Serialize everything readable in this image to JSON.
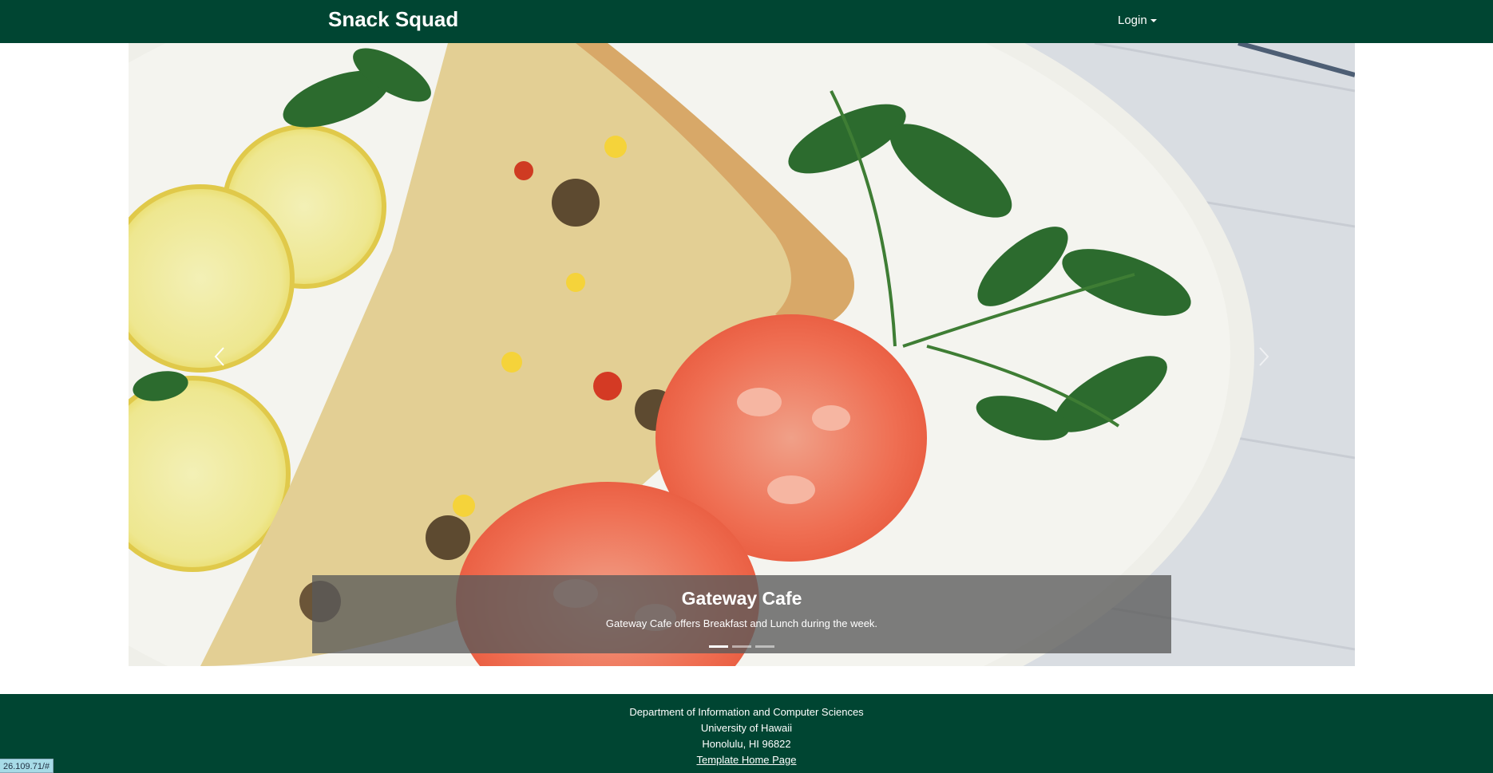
{
  "navbar": {
    "brand": "Snack Squad",
    "login_label": "Login",
    "login_icon": "caret-down-icon"
  },
  "carousel": {
    "slide": {
      "title": "Gateway Cafe",
      "description": "Gateway Cafe offers Breakfast and Lunch during the week."
    },
    "slide_count": 3,
    "active_index": 0,
    "prev_icon": "chevron-left-icon",
    "next_icon": "chevron-right-icon"
  },
  "footer": {
    "line1": "Department of Information and Computer Sciences",
    "line2": "University of Hawaii",
    "line3": "Honolulu, HI 96822",
    "link": "Template Home Page"
  },
  "status_bar": {
    "url": "26.109.71/#"
  },
  "colors": {
    "brand_green": "#004532",
    "caption_bg": "#5a5a5a"
  }
}
